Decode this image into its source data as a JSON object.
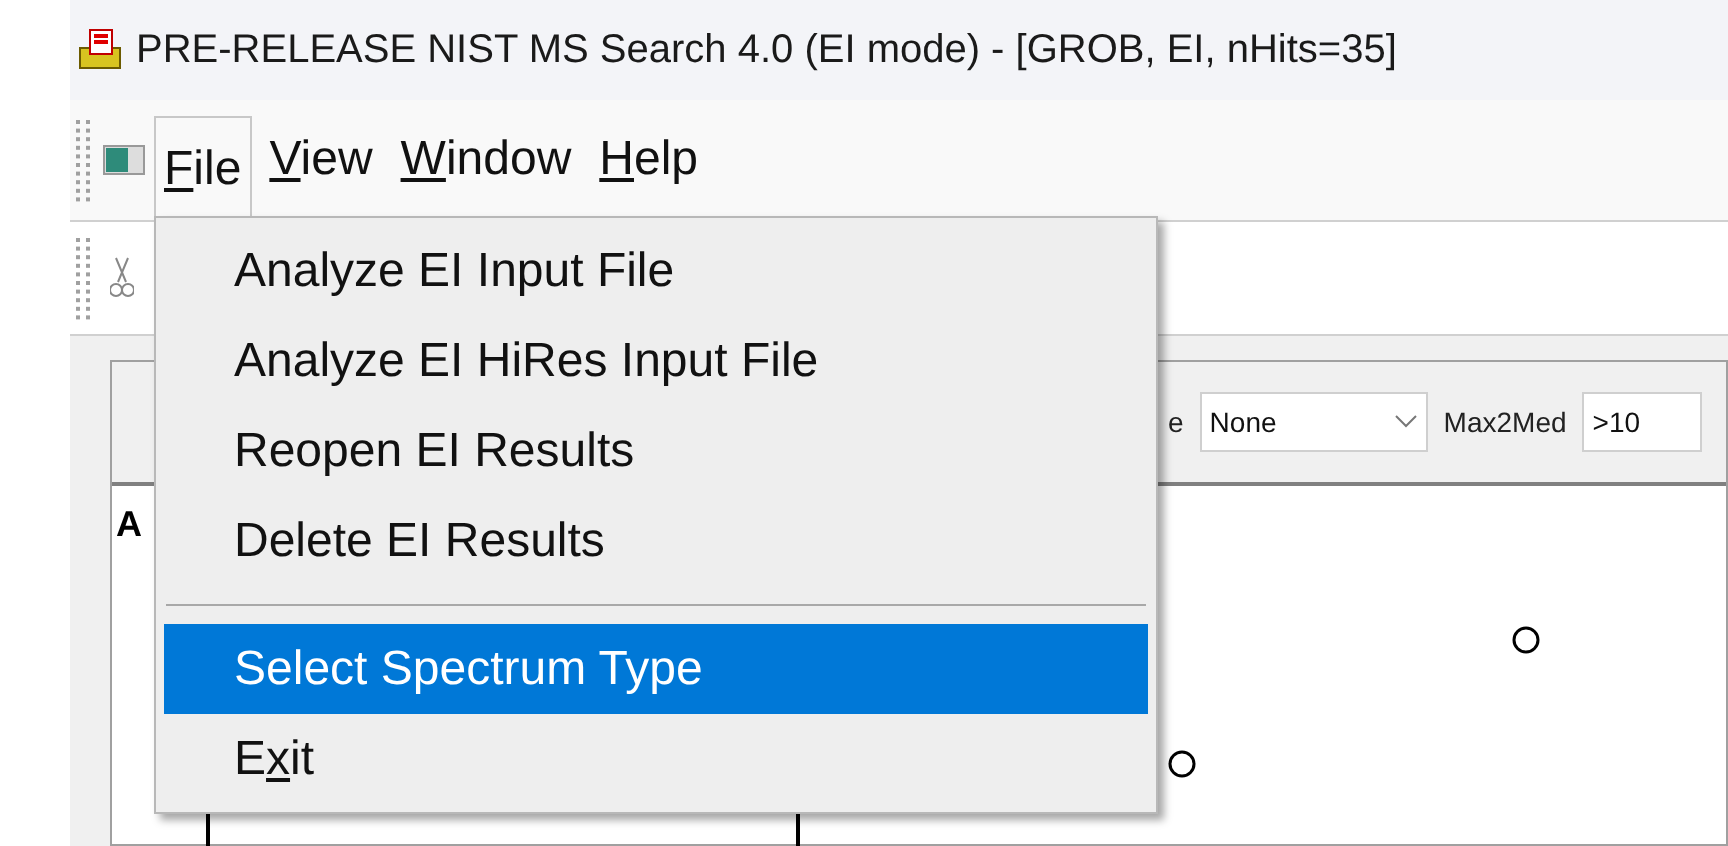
{
  "window": {
    "title": "PRE-RELEASE NIST MS Search 4.0 (EI mode) - [GROB, EI, nHits=35]"
  },
  "menu_bar": [
    {
      "label": "File",
      "underline_first": true,
      "open": true
    },
    {
      "label": "View",
      "underline_first": true,
      "open": false
    },
    {
      "label": "Window",
      "underline_first": true,
      "open": false
    },
    {
      "label": "Help",
      "underline_first": true,
      "open": false
    }
  ],
  "file_menu": [
    {
      "kind": "item",
      "label": "Analyze EI Input File",
      "highlighted": false
    },
    {
      "kind": "item",
      "label": "Analyze EI HiRes Input File",
      "highlighted": false
    },
    {
      "kind": "item",
      "label": "Reopen EI Results",
      "highlighted": false
    },
    {
      "kind": "item",
      "label": "Delete EI Results",
      "highlighted": false
    },
    {
      "kind": "separator"
    },
    {
      "kind": "item",
      "label": "Select Spectrum Type",
      "highlighted": true
    },
    {
      "kind": "item",
      "label": "Exit",
      "underline_second": true,
      "highlighted": false
    }
  ],
  "filter_bar": {
    "label_tail": "e",
    "select": {
      "value": "None"
    },
    "max2med": {
      "label": "Max2Med",
      "value": ">10"
    }
  },
  "plot": {
    "label": "A"
  }
}
